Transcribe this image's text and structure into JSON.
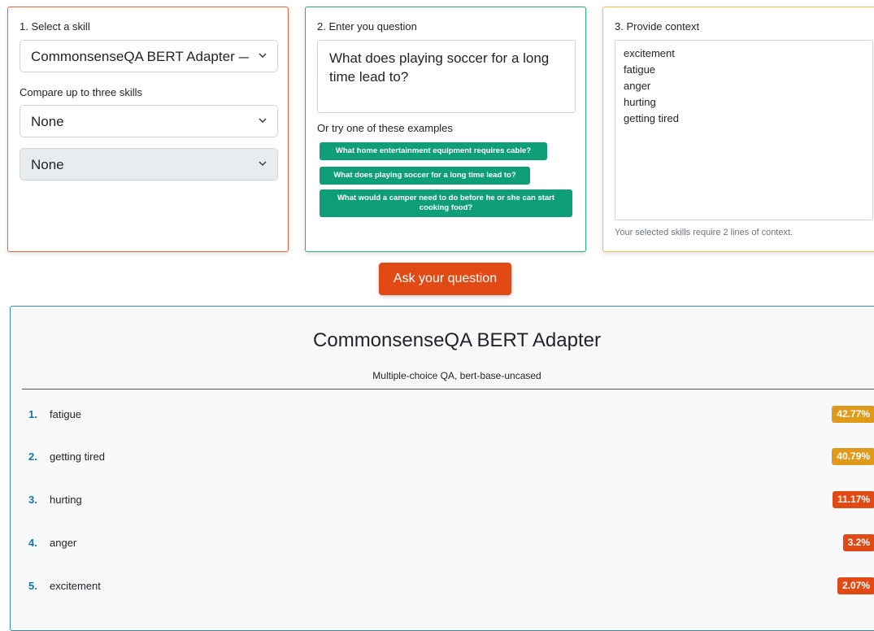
{
  "skill_card": {
    "title": "1. Select a skill",
    "selected_skill": "CommonsenseQA BERT Adapter — Multiple-choice QA",
    "compare_label": "Compare up to three skills",
    "compare_1": "None",
    "compare_2": "None"
  },
  "question_card": {
    "title": "2. Enter you question",
    "question": "What does playing soccer for a long time lead to?",
    "examples_label": "Or try one of these examples",
    "examples": [
      "What home entertainment equipment requires cable?",
      "What does playing soccer for a long time lead to?",
      "What would a camper need to do before he or she can start cooking food?"
    ]
  },
  "context_card": {
    "title": "3. Provide context",
    "context_lines": [
      "excitement",
      "fatigue",
      "anger",
      "hurting",
      "getting tired"
    ],
    "note": "Your selected skills require 2 lines of context."
  },
  "ask_button": "Ask your question",
  "results": {
    "title": "CommonsenseQA BERT Adapter",
    "subtitle": "Multiple-choice QA, bert-base-uncased",
    "items": [
      {
        "rank": "1.",
        "label": "fatigue",
        "score": "42.77%",
        "color": "#e09a1a"
      },
      {
        "rank": "2.",
        "label": "getting tired",
        "score": "40.79%",
        "color": "#e09a1a"
      },
      {
        "rank": "3.",
        "label": "hurting",
        "score": "11.17%",
        "color": "#e24a15"
      },
      {
        "rank": "4.",
        "label": "anger",
        "score": "3.2%",
        "color": "#e24a15"
      },
      {
        "rank": "5.",
        "label": "excitement",
        "score": "2.07%",
        "color": "#e24a15"
      }
    ]
  },
  "icons": {
    "select_chevron": "chevron-down-icon"
  }
}
